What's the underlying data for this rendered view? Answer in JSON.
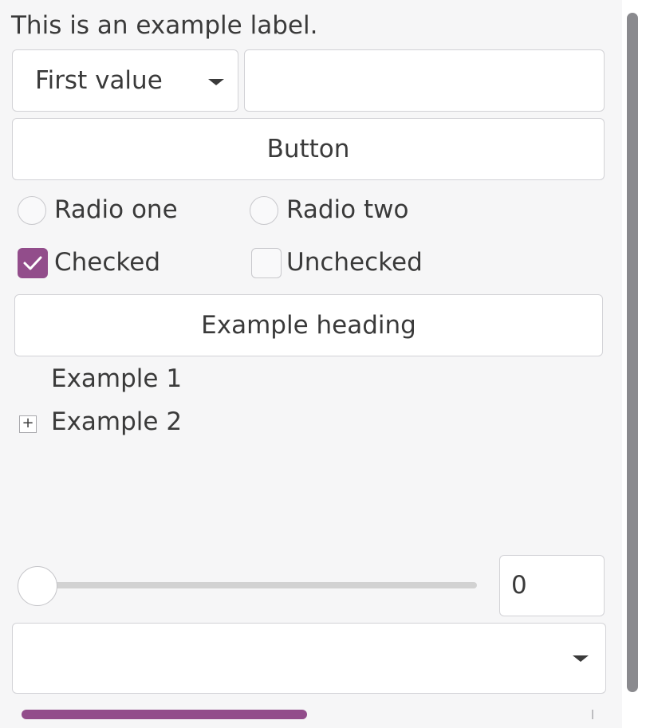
{
  "label": {
    "text": "This is an example label."
  },
  "combo": {
    "value": "First value",
    "icon": "chevron-down-icon"
  },
  "entry": {
    "value": ""
  },
  "button": {
    "label": "Button"
  },
  "radios": [
    {
      "label": "Radio one",
      "selected": false
    },
    {
      "label": "Radio two",
      "selected": false
    }
  ],
  "checks": [
    {
      "label": "Checked",
      "checked": true
    },
    {
      "label": "Unchecked",
      "checked": false
    }
  ],
  "heading": {
    "label": "Example heading"
  },
  "tree": {
    "items": [
      {
        "label": "Example 1",
        "expandable": false
      },
      {
        "label": "Example 2",
        "expandable": true,
        "expander_glyph": "+"
      }
    ]
  },
  "slider": {
    "value": 0
  },
  "spin": {
    "value": "0"
  },
  "bottom_combo": {
    "value": "",
    "icon": "chevron-down-icon"
  },
  "scrollbars": {
    "horizontal_position": 0,
    "horizontal_fraction_visible": 0.5
  },
  "colors": {
    "accent": "#924d8b",
    "panel_bg": "#f6f6f7",
    "border": "#d2d2d6",
    "text": "#3a3a3a"
  }
}
